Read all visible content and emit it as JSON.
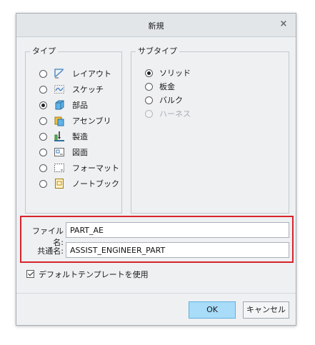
{
  "dialog": {
    "title": "新規",
    "close_symbol": "×"
  },
  "type_group": {
    "legend": "タイプ",
    "items": [
      {
        "label": "レイアウト",
        "icon": "layout-icon",
        "selected": false
      },
      {
        "label": "スケッチ",
        "icon": "sketch-icon",
        "selected": false
      },
      {
        "label": "部品",
        "icon": "part-icon",
        "selected": true
      },
      {
        "label": "アセンブリ",
        "icon": "assembly-icon",
        "selected": false
      },
      {
        "label": "製造",
        "icon": "manufacturing-icon",
        "selected": false
      },
      {
        "label": "図面",
        "icon": "drawing-icon",
        "selected": false
      },
      {
        "label": "フォーマット",
        "icon": "format-icon",
        "selected": false
      },
      {
        "label": "ノートブック",
        "icon": "notebook-icon",
        "selected": false
      }
    ]
  },
  "subtype_group": {
    "legend": "サブタイプ",
    "items": [
      {
        "label": "ソリッド",
        "selected": true,
        "enabled": true
      },
      {
        "label": "板金",
        "selected": false,
        "enabled": true
      },
      {
        "label": "バルク",
        "selected": false,
        "enabled": true
      },
      {
        "label": "ハーネス",
        "selected": false,
        "enabled": false
      }
    ]
  },
  "fields": {
    "file_name_label": "ファイル名:",
    "file_name_value": "PART_AE",
    "common_name_label": "共通名:",
    "common_name_value": "ASSIST_ENGINEER_PART"
  },
  "options": {
    "use_default_template_label": "デフォルトテンプレートを使用",
    "use_default_template_checked": true
  },
  "buttons": {
    "ok": "OK",
    "cancel": "キャンセル"
  },
  "colors": {
    "highlight_border": "#d8232a",
    "ok_button": "#a8dcf8"
  }
}
